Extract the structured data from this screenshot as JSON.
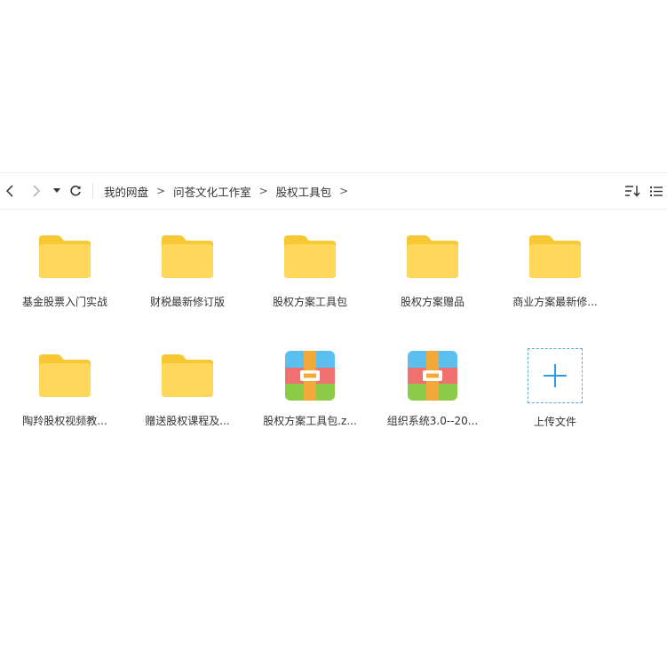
{
  "toolbar": {
    "back_icon": "chevron-left-icon",
    "forward_icon": "chevron-right-icon",
    "dropdown_icon": "caret-down-icon",
    "refresh_icon": "refresh-icon",
    "sort_icon": "sort-icon",
    "view_icon": "list-view-icon"
  },
  "breadcrumb": {
    "items": [
      "我的网盘",
      "问苍文化工作室",
      "股权工具包"
    ],
    "separator": ">"
  },
  "files": [
    {
      "name": "基金股票入门实战",
      "type": "folder"
    },
    {
      "name": "财税最新修订版",
      "type": "folder"
    },
    {
      "name": "股权方案工具包",
      "type": "folder"
    },
    {
      "name": "股权方案赠品",
      "type": "folder"
    },
    {
      "name": "商业方案最新修...",
      "type": "folder"
    },
    {
      "name": "陶羚股权视频教...",
      "type": "folder"
    },
    {
      "name": "赠送股权课程及...",
      "type": "folder"
    },
    {
      "name": "股权方案工具包.z...",
      "type": "archive"
    },
    {
      "name": "组织系统3.0--20...",
      "type": "archive"
    }
  ],
  "upload": {
    "label": "上传文件",
    "icon": "plus-icon"
  },
  "colors": {
    "folder_front": "#FFD75A",
    "folder_back": "#F8C834",
    "archive_blue": "#5BC0F0",
    "archive_red": "#F07070",
    "archive_green": "#8BCB48",
    "archive_strap": "#F3A83A",
    "accent": "#2E9BE6"
  }
}
